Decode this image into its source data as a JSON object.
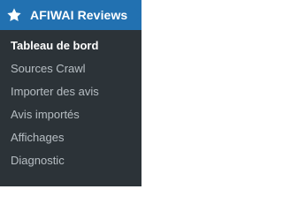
{
  "menu": {
    "title": "AFIWAI Reviews",
    "icon": "star-icon",
    "colors": {
      "accent": "#2271b1",
      "submenu_bg": "#2c3338",
      "text": "#ffffff"
    },
    "items": [
      {
        "label": "Tableau de bord",
        "current": true
      },
      {
        "label": "Sources Crawl",
        "current": false
      },
      {
        "label": "Importer des avis",
        "current": false
      },
      {
        "label": "Avis importés",
        "current": false
      },
      {
        "label": "Affichages",
        "current": false
      },
      {
        "label": "Diagnostic",
        "current": false
      }
    ]
  }
}
